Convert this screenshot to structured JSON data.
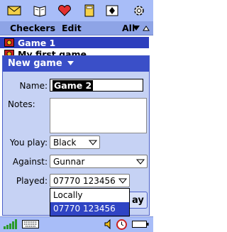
{
  "launcher": {
    "icons": [
      "envelope-icon",
      "book-icon",
      "heart-icon",
      "note-icon",
      "cards-icon",
      "gear-icon"
    ]
  },
  "menubar": {
    "app": "Checkers",
    "edit": "Edit",
    "filter": "All"
  },
  "games": [
    {
      "label": "Game 1",
      "selected": true
    },
    {
      "label": "My first game",
      "selected": false
    }
  ],
  "dialog": {
    "title": "New game",
    "name_label": "Name:",
    "name_value": "Game 2",
    "notes_label": "Notes:",
    "notes_value": "",
    "you_play_label": "You play:",
    "you_play_value": "Black",
    "against_label": "Against:",
    "against_value": "Gunnar",
    "played_label": "Played:",
    "played_value": "07770 123456",
    "played_options": [
      "Locally",
      "07770 123456"
    ],
    "ok_partial": "ay"
  },
  "statusbar": {
    "icons": [
      "signal-icon",
      "keyboard-icon",
      "speaker-icon",
      "clock-icon",
      "battery-icon"
    ]
  },
  "colors": {
    "bar_light": "#a8bdf8",
    "bar_mid": "#8ea4e6",
    "selection": "#2e3fbd",
    "dialog_bg": "#c6d2f4"
  }
}
